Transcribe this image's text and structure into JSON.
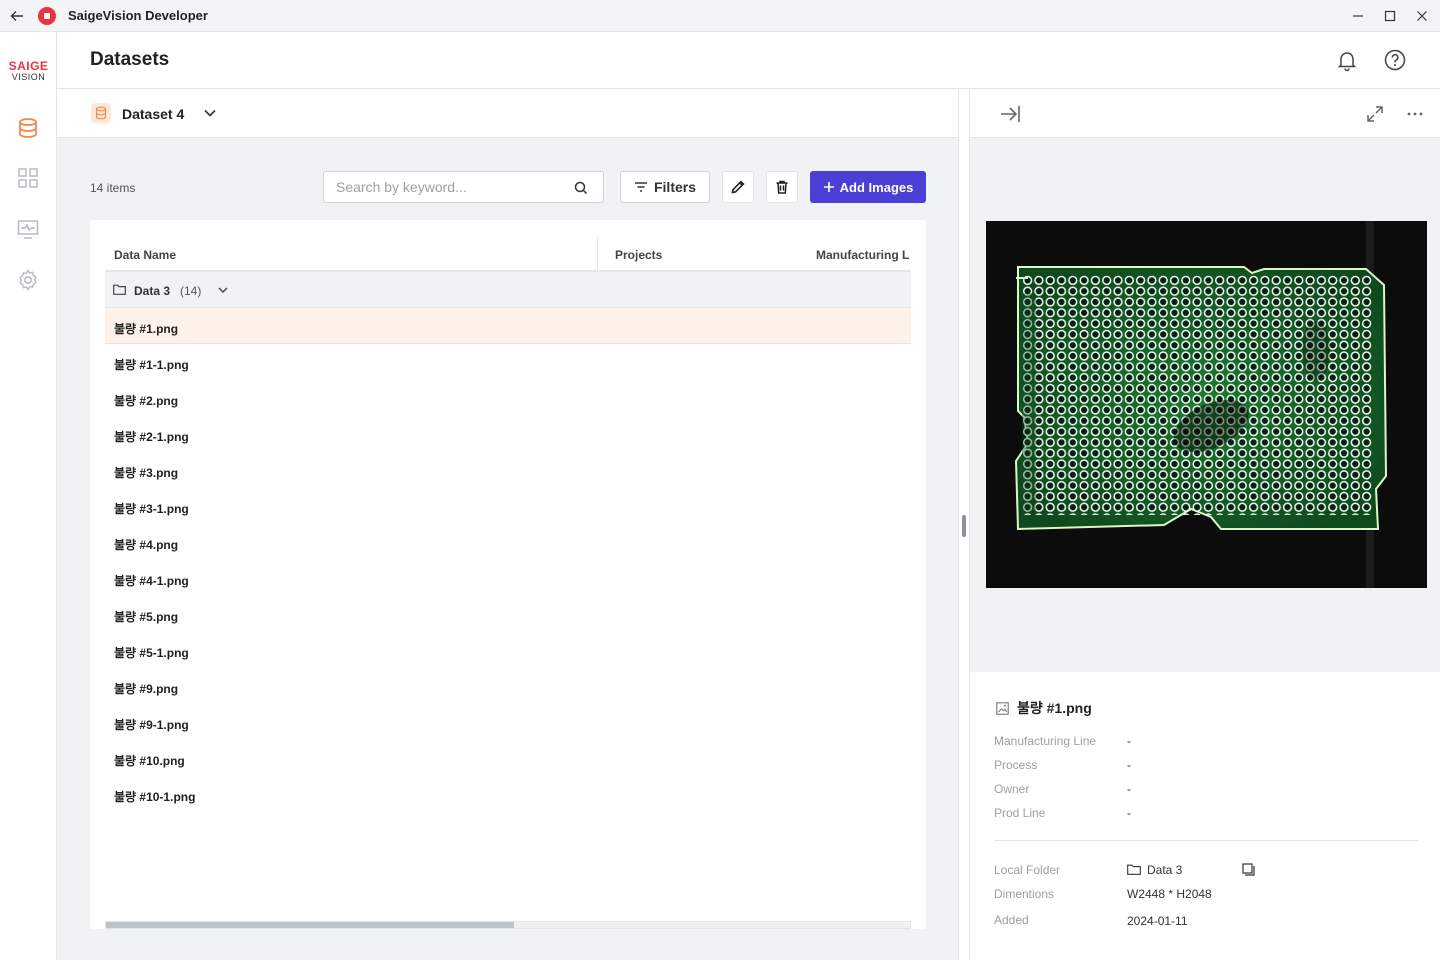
{
  "window": {
    "title": "SaigeVision Developer"
  },
  "brand": {
    "main": "SAIGE",
    "sub": "VISION"
  },
  "header": {
    "title": "Datasets"
  },
  "dataset": {
    "name": "Dataset 4"
  },
  "toolbar": {
    "items_count": "14 items",
    "search_placeholder": "Search by keyword...",
    "filters_label": "Filters",
    "add_label": "Add Images"
  },
  "table": {
    "columns": [
      "Data Name",
      "Projects",
      "Manufacturing L"
    ],
    "group": {
      "name": "Data 3",
      "count": "(14)"
    },
    "rows": [
      "불량 #1.png",
      "불량 #1-1.png",
      "불량 #2.png",
      "불량 #2-1.png",
      "불량 #3.png",
      "불량 #3-1.png",
      "불량 #4.png",
      "불량 #4-1.png",
      "불량 #5.png",
      "불량 #5-1.png",
      "불량 #9.png",
      "불량 #9-1.png",
      "불량 #10.png",
      "불량 #10-1.png"
    ],
    "selected_index": 0
  },
  "detail": {
    "file_name": "불량 #1.png",
    "fields": [
      {
        "key": "Manufacturing Line",
        "value": "-"
      },
      {
        "key": "Process",
        "value": "-"
      },
      {
        "key": "Owner",
        "value": "-"
      },
      {
        "key": "Prod Line",
        "value": "-"
      }
    ],
    "local_folder_label": "Local Folder",
    "local_folder_value": "Data 3",
    "dimensions_label": "Dimentions",
    "dimensions_value": "W2448 * H2048",
    "added_label": "Added",
    "added_value": "2024-01-11"
  },
  "colors": {
    "accent": "#4b3fd6",
    "brand": "#e8343f",
    "selected_row": "#fdf1e9",
    "dataset_icon": "#f08a4b"
  },
  "icons": {
    "back": "arrow-left-icon",
    "app": "app-logo-icon",
    "minimize": "minimize-icon",
    "maximize": "maximize-icon",
    "close": "close-icon",
    "nav": [
      "database-icon",
      "grid-icon",
      "monitor-icon",
      "gear-icon"
    ],
    "bell": "bell-icon",
    "help": "help-icon",
    "search": "search-icon",
    "filter": "filter-icon",
    "edit": "pencil-icon",
    "delete": "trash-icon",
    "add": "plus-icon",
    "collapse_panel": "collapse-right-icon",
    "expand": "expand-icon",
    "more": "more-horizontal-icon",
    "image_file": "image-file-icon",
    "folder": "folder-icon",
    "copy": "copy-icon"
  }
}
